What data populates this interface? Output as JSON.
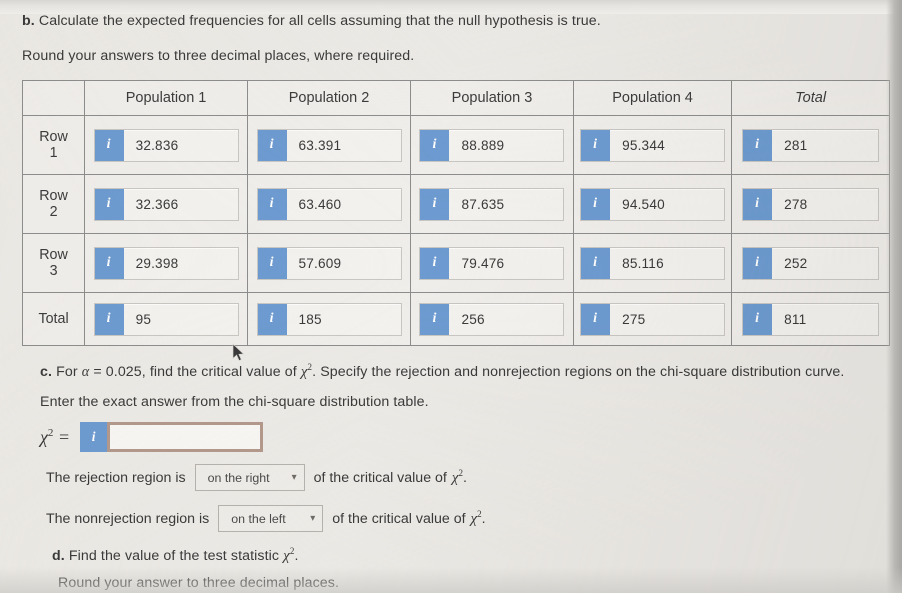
{
  "part_b": {
    "prompt": "b. Calculate the expected frequencies for all cells assuming that the null hypothesis is true.",
    "prompt_label": "b.",
    "prompt_text": "Calculate the expected frequencies for all cells assuming that the null hypothesis is true.",
    "rounding_note": "Round your answers to three decimal places, where required."
  },
  "table": {
    "corner_header": "",
    "column_headers": [
      "Population 1",
      "Population 2",
      "Population 3",
      "Population 4",
      "Total"
    ],
    "row_labels": [
      "Row 1",
      "Row 2",
      "Row 3",
      "Total"
    ],
    "row_label_lines": [
      [
        "Row",
        "1"
      ],
      [
        "Row",
        "2"
      ],
      [
        "Row",
        "3"
      ],
      [
        "Total",
        ""
      ]
    ],
    "info_icon": "i",
    "rows": [
      {
        "label": "Row 1",
        "values": [
          "32.836",
          "63.391",
          "88.889",
          "95.344",
          "281"
        ]
      },
      {
        "label": "Row 2",
        "values": [
          "32.366",
          "63.460",
          "87.635",
          "94.540",
          "278"
        ]
      },
      {
        "label": "Row 3",
        "values": [
          "29.398",
          "57.609",
          "79.476",
          "85.116",
          "252"
        ]
      },
      {
        "label": "Total",
        "values": [
          "95",
          "185",
          "256",
          "275",
          "811"
        ]
      }
    ]
  },
  "part_c": {
    "label": "c.",
    "text_1": "For",
    "alpha": "α",
    "equals": "=",
    "alpha_value": "0.025",
    "text_2": ", find the critical value of",
    "chi": "χ",
    "exponent": "2",
    "text_3": ". Specify the rejection and nonrejection regions on the chi-square distribution curve.",
    "instruction": "Enter the exact answer from the chi-square distribution table.",
    "answer": {
      "symbol": "χ",
      "exponent": "2",
      "equals": "=",
      "info_icon": "i",
      "value": "",
      "placeholder": ""
    },
    "rejection": {
      "prefix": "The rejection region is",
      "selected": "on the right",
      "options": [
        "on the right",
        "on the left"
      ],
      "suffix": "of the critical value of",
      "chi": "χ",
      "exponent": "2",
      "period": "."
    },
    "nonrejection": {
      "prefix": "The nonrejection region is",
      "selected": "on the left",
      "options": [
        "on the right",
        "on the left"
      ],
      "suffix": "of the critical value of",
      "chi": "χ",
      "exponent": "2",
      "period": "."
    }
  },
  "part_d": {
    "label": "d.",
    "text": "Find the value of the test statistic",
    "chi": "χ",
    "exponent": "2",
    "period": ".",
    "rounding_note": "Round your answer to three decimal places."
  },
  "colors": {
    "info_blue": "#6d9bd1",
    "page_bg": "#eceae6",
    "table_border": "#8d8d8d",
    "focus_border": "#b3998c",
    "text": "#3a3a3a"
  }
}
